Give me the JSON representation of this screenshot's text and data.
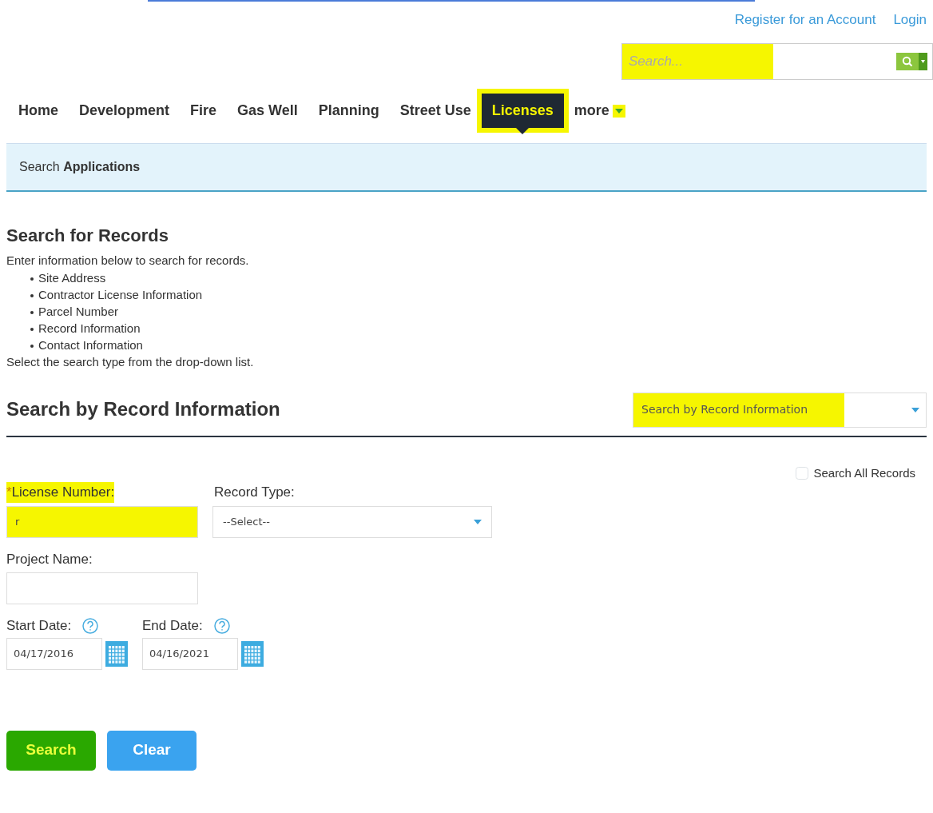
{
  "header_links": [
    {
      "label": "Register for an Account"
    },
    {
      "label": "Login"
    }
  ],
  "global_search": {
    "placeholder": "Search...",
    "highlighted": true
  },
  "nav_tabs": [
    {
      "label": "Home",
      "selected": false,
      "kind": "link"
    },
    {
      "label": "Development",
      "selected": false,
      "kind": "link"
    },
    {
      "label": "Fire",
      "selected": false,
      "kind": "link"
    },
    {
      "label": "Gas Well",
      "selected": false,
      "kind": "link"
    },
    {
      "label": "Planning",
      "selected": false,
      "kind": "link"
    },
    {
      "label": "Street Use",
      "selected": false,
      "kind": "link"
    },
    {
      "label": "Licenses",
      "selected": true,
      "kind": "link",
      "highlighted": true
    },
    {
      "label": "more",
      "selected": false,
      "kind": "menu",
      "highlighted": true
    }
  ],
  "breadcrumb_bar": {
    "text": "Search **Applications**"
  },
  "intro": {
    "title": "Search for Records",
    "text": "Enter information below to search for records.",
    "bullets": [
      "Site Address",
      "Contractor License Information",
      "Parcel Number",
      "Record Information",
      "Contact Information"
    ],
    "footer": "Select the search type from the drop-down list."
  },
  "search_section": {
    "title": "Search by Record Information",
    "search_type": {
      "value": "Search by Record Information",
      "highlighted": true
    }
  },
  "search_all": {
    "label": "Search All Records",
    "checked": false
  },
  "form_rows": [
    [
      {
        "kind": "text",
        "label": "License Number:",
        "required_mark": "*",
        "value": "r",
        "highlighted": true
      },
      {
        "kind": "select",
        "label": "Record Type:",
        "value": "--Select--"
      }
    ],
    [
      {
        "kind": "text",
        "label": "Project Name:"
      }
    ],
    [
      {
        "kind": "date",
        "label": "Start Date:",
        "value": "04/17/2016"
      },
      {
        "kind": "date",
        "label": "End Date:",
        "value": "04/16/2021"
      }
    ]
  ],
  "buttons": [
    {
      "label": "Search",
      "kind": "primary",
      "highlighted": true
    },
    {
      "label": "Clear",
      "kind": "secondary"
    }
  ]
}
